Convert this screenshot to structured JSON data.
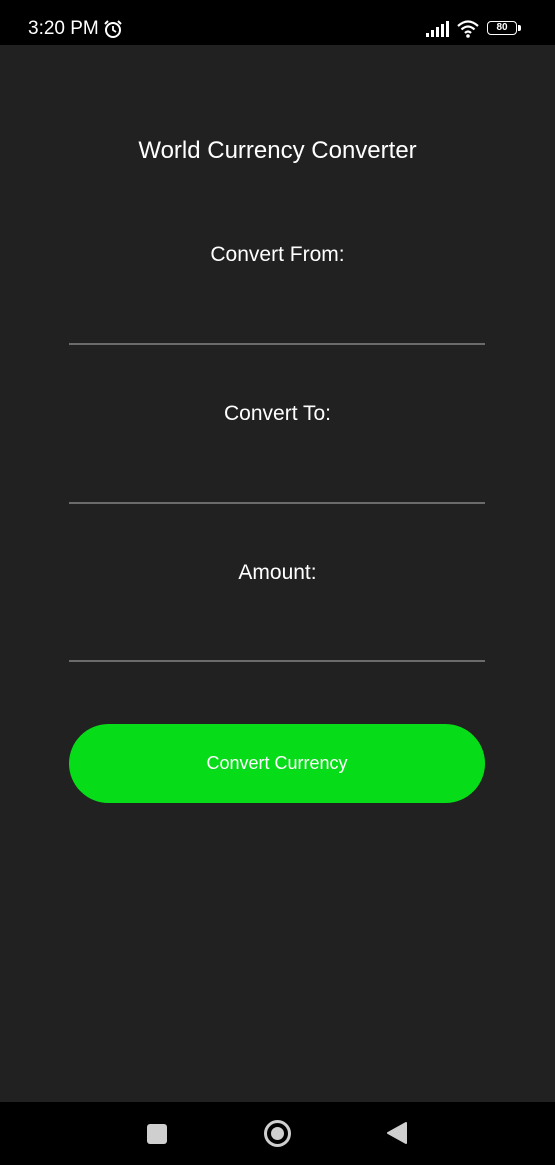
{
  "status_bar": {
    "time": "3:20 PM",
    "battery_level": "80",
    "icons": [
      "alarm-icon",
      "signal-icon",
      "wifi-icon",
      "battery-icon"
    ]
  },
  "app": {
    "title": "World Currency Converter",
    "fields": {
      "from": {
        "label": "Convert From:",
        "value": "",
        "placeholder": ""
      },
      "to": {
        "label": "Convert To:",
        "value": "",
        "placeholder": ""
      },
      "amount": {
        "label": "Amount:",
        "value": "",
        "placeholder": ""
      }
    },
    "button_label": "Convert Currency"
  },
  "nav_bar": {
    "icons": [
      "recents-icon",
      "home-icon",
      "back-icon"
    ]
  },
  "colors": {
    "background": "#212121",
    "accent": "#06dd18",
    "underline": "#6b6b6b",
    "text": "#ffffff"
  }
}
